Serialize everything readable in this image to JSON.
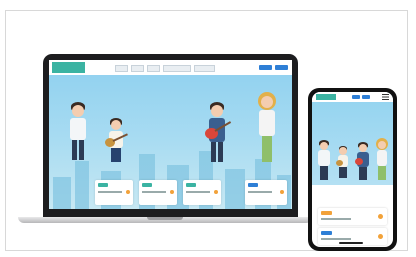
{
  "colors": {
    "brand_teal": "#3bb3a2",
    "catch_teal": "#1bb0a4",
    "nav_button_blue": "#2e7fd6",
    "sky_blue": "#8ed0ef",
    "accent_orange": "#f2a23a",
    "guitar_red": "#d9463a",
    "laptop_bezel": "#1d1d1f"
  },
  "laptop": {
    "site": {
      "logo_text": "",
      "nav_items": [
        "",
        "",
        "",
        "",
        ""
      ],
      "hero_small_text": "",
      "hero_catch_lines": [
        "",
        "",
        ""
      ],
      "cards": [
        {
          "tag": "",
          "text": ""
        },
        {
          "tag": "",
          "text": ""
        },
        {
          "tag": "",
          "text": ""
        },
        {
          "tag": "",
          "text": ""
        }
      ]
    }
  },
  "phone": {
    "site": {
      "logo_text": "",
      "hero_small_text": "",
      "hero_catch_lines": [
        "",
        ""
      ],
      "cards": [
        {
          "tag": "",
          "text": ""
        },
        {
          "tag": "",
          "text": ""
        }
      ]
    }
  },
  "icons": {
    "menu": "hamburger-menu-icon",
    "arrow": "circle-arrow-icon"
  }
}
